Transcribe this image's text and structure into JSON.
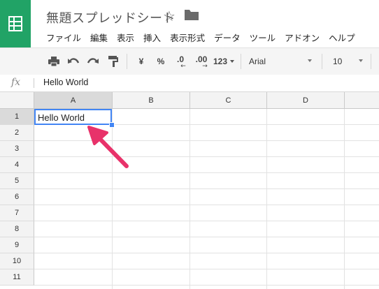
{
  "document": {
    "title": "無題スプレッドシート"
  },
  "menu": [
    "ファイル",
    "編集",
    "表示",
    "挿入",
    "表示形式",
    "データ",
    "ツール",
    "アドオン",
    "ヘルプ"
  ],
  "toolbar": {
    "currency": "¥",
    "percent": "%",
    "decimal_decrease": ".0",
    "decimal_increase": ".00",
    "more_formats": "123",
    "font": "Arial",
    "font_size": "10"
  },
  "formula_bar": {
    "fx_label": "fx",
    "value": "Hello World"
  },
  "columns": [
    "A",
    "B",
    "C",
    "D"
  ],
  "rows": [
    "1",
    "2",
    "3",
    "4",
    "5",
    "6",
    "7",
    "8",
    "9",
    "10",
    "11"
  ],
  "selected_cell": {
    "column": "A",
    "row": "1",
    "value": "Hello World"
  },
  "colors": {
    "brand": "#21a366",
    "selection": "#4285f4",
    "arrow": "#e8326a"
  }
}
